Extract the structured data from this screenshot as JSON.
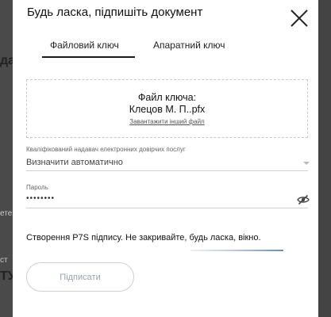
{
  "background": {
    "left_fragments": [
      "да",
      "ете",
      "ст",
      "ТУ"
    ]
  },
  "dialog": {
    "title": "Будь ласка, підпишіть документ",
    "close_icon": "close-icon",
    "tabs": [
      {
        "label": "Файловий ключ",
        "active": true
      },
      {
        "label": "Апаратний ключ",
        "active": false
      }
    ],
    "key_file": {
      "label": "Файл ключа:",
      "name": "Клецов М. П..pfx",
      "change_link": "Завантажити інший файл"
    },
    "provider": {
      "label": "Кваліфікований надавач електронних довірчих послуг",
      "value": "Визначити автоматично"
    },
    "password": {
      "label": "Пароль",
      "value": "••••••••",
      "toggle_icon": "eye-off-icon"
    },
    "status": {
      "text": "Створення P7S підпису. Не закривайте, будь ласка, вікно."
    },
    "sign_button": "Підписати"
  },
  "colors": {
    "overlay": "#3b3b3b",
    "accent": "#6b8fba",
    "text": "#111111"
  }
}
